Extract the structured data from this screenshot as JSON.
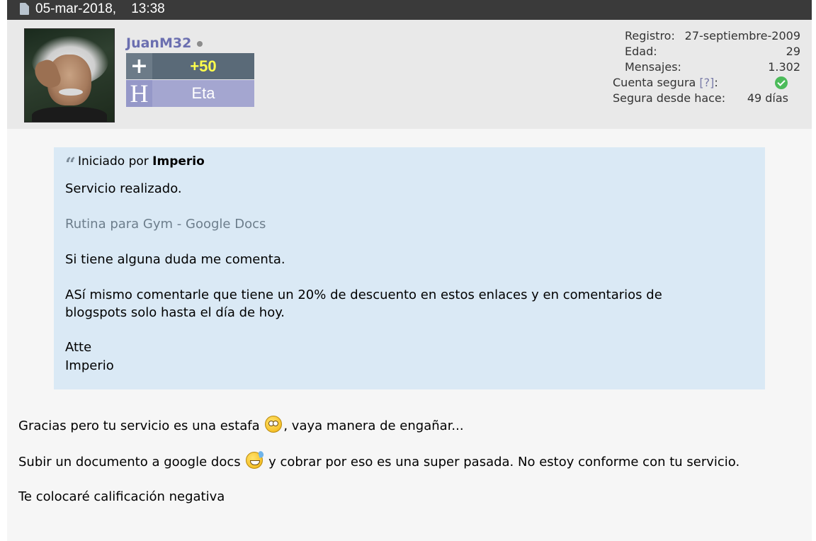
{
  "post": {
    "date": "05-mar-2018,",
    "time": "13:38"
  },
  "user": {
    "name": "JuanM32",
    "reputation": "+50",
    "rank_letter": "H",
    "rank_name": "Eta"
  },
  "stats": {
    "registro_label": "Registro:",
    "registro_value": "27-septiembre-2009",
    "edad_label": "Edad:",
    "edad_value": "29",
    "mensajes_label": "Mensajes:",
    "mensajes_value": "1.302",
    "cuenta_label": "Cuenta segura",
    "cuenta_help": "[?]",
    "cuenta_colon": ":",
    "segura_label": "Segura desde hace:",
    "segura_value": "49 días"
  },
  "quote": {
    "prefix": "Iniciado por",
    "author": "Imperio",
    "lines": [
      "Servicio realizado.",
      "Rutina para Gym - Google Docs",
      "Si tiene alguna duda me comenta.",
      "ASí mismo comentarle que tiene un 20% de descuento en estos enlaces y en comentarios de",
      "blogspots solo hasta el día de hoy.",
      "Atte",
      "Imperio"
    ]
  },
  "reply": {
    "line1_a": "Gracias pero tu servicio es una estafa",
    "line1_b": ", vaya manera de engañar...",
    "line2_a": "Subir un documento a google docs",
    "line2_b": " y cobrar por eso es una super pasada. No estoy conforme con tu servicio.",
    "line3": "Te colocaré calificación negativa"
  },
  "icons": {
    "post": "document-icon",
    "quote": "quote-icon",
    "online": "status-dot-icon",
    "secure": "check-icon",
    "emoji1": "flushed-emoji-icon",
    "emoji2": "sweat-smile-emoji-icon"
  },
  "colors": {
    "username": "#6b6fb0",
    "reputation": "#ffff4c",
    "quote_bg": "#dae9f5",
    "link": "#6d7e8c"
  }
}
